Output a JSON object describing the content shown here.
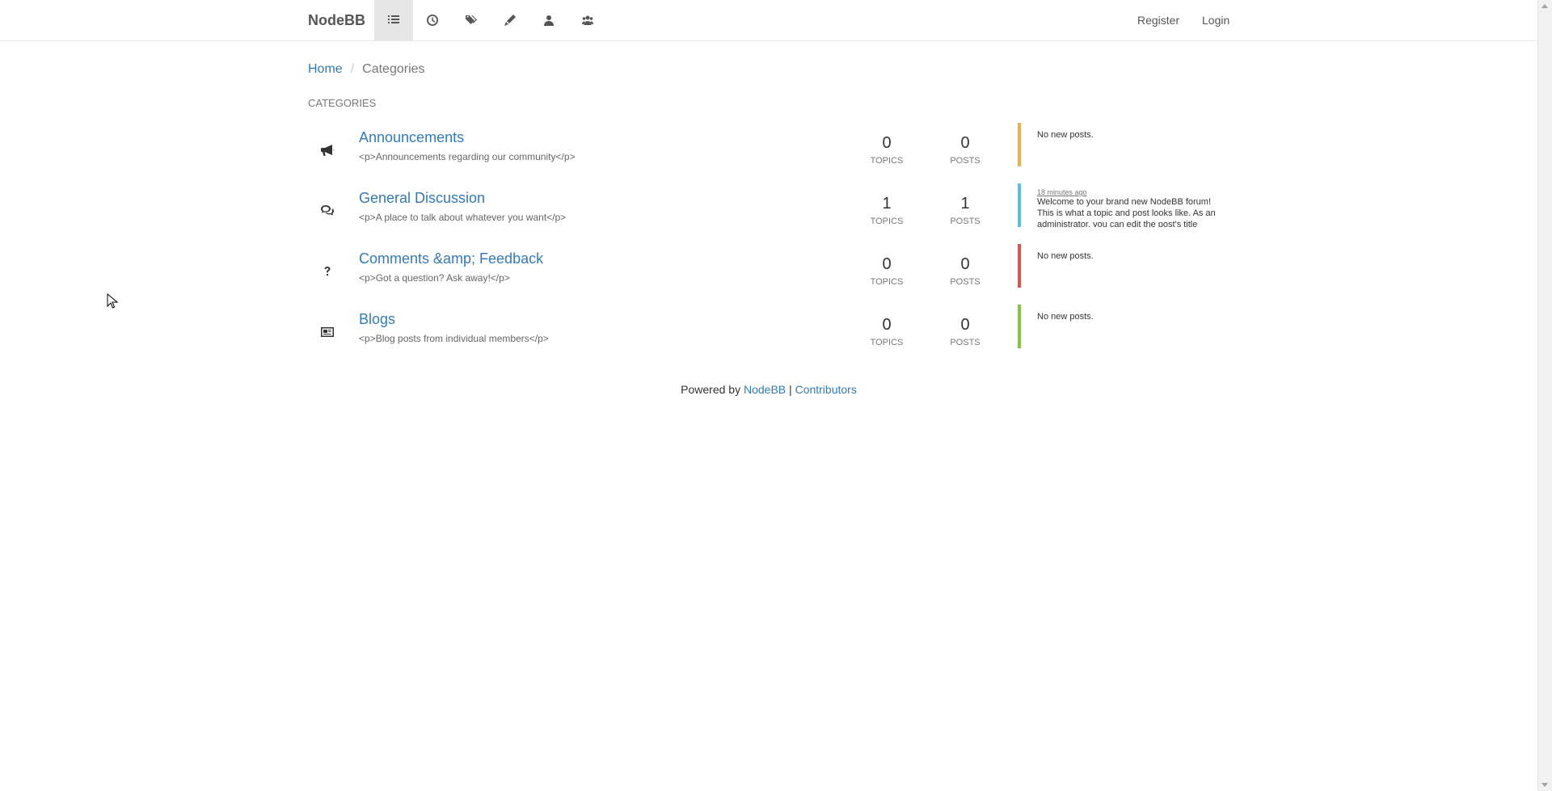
{
  "navbar": {
    "brand": "NodeBB",
    "icons": [
      "categories-icon",
      "recent-icon",
      "tags-icon",
      "popular-icon",
      "users-icon",
      "groups-icon"
    ],
    "register_label": "Register",
    "login_label": "Login"
  },
  "breadcrumb": {
    "home": "Home",
    "separator": "/",
    "current": "Categories"
  },
  "section_title": "CATEGORIES",
  "categories": [
    {
      "name": "Announcements",
      "description": "<p>Announcements regarding our community</p>",
      "icon": "bullhorn-icon",
      "topics": "0",
      "posts": "0",
      "topics_label": "TOPICS",
      "posts_label": "POSTS",
      "color": "#f0ad4e",
      "teaser": "No new posts."
    },
    {
      "name": "General Discussion",
      "description": "<p>A place to talk about whatever you want</p>",
      "icon": "comments-icon",
      "topics": "1",
      "posts": "1",
      "topics_label": "TOPICS",
      "posts_label": "POSTS",
      "color": "#5bc0de",
      "teaser_time": "18 minutes ago",
      "teaser_body": "Welcome to your brand new NodeBB forum! This is what a topic and post looks like. As an administrator, you can edit the post's title"
    },
    {
      "name": "Comments &amp; Feedback",
      "description": "<p>Got a question? Ask away!</p>",
      "icon": "question-icon",
      "topics": "0",
      "posts": "0",
      "topics_label": "TOPICS",
      "posts_label": "POSTS",
      "color": "#d9534f",
      "teaser": "No new posts."
    },
    {
      "name": "Blogs",
      "description": "<p>Blog posts from individual members</p>",
      "icon": "newspaper-icon",
      "topics": "0",
      "posts": "0",
      "topics_label": "TOPICS",
      "posts_label": "POSTS",
      "color": "#86c541",
      "teaser": "No new posts."
    }
  ],
  "footer": {
    "prefix": "Powered by",
    "nodebb_link": "NodeBB",
    "separator": "|",
    "contributors_link": "Contributors"
  }
}
